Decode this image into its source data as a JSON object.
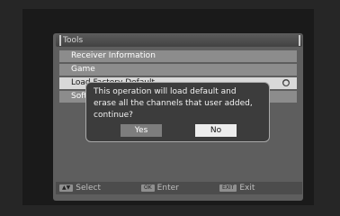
{
  "window": {
    "title": "Tools"
  },
  "menu": {
    "items": [
      {
        "label": "Receiver Information"
      },
      {
        "label": "Game"
      },
      {
        "label": "Load Factory Default"
      },
      {
        "label": "Software Upgrade"
      }
    ]
  },
  "dialog": {
    "line1": "This operation will load default and",
    "line2": "erase all the channels that user added,",
    "line3": "continue?",
    "yes_label": "Yes",
    "no_label": "No",
    "selected": "No"
  },
  "footer": {
    "select": {
      "key_icon": "up-down-arrows",
      "label": "Select"
    },
    "enter": {
      "key": "OK",
      "label": "Enter"
    },
    "exit": {
      "key": "EXIT",
      "label": "Exit"
    }
  }
}
